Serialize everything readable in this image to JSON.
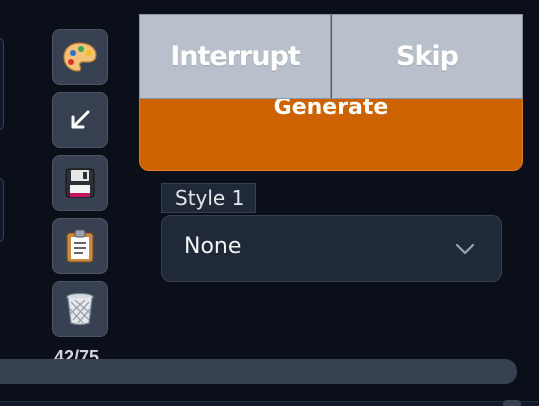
{
  "toolbar": {
    "buttons": [
      {
        "name": "palette",
        "icon": "palette-icon"
      },
      {
        "name": "paste",
        "icon": "arrow-down-left-icon"
      },
      {
        "name": "save",
        "icon": "floppy-disk-icon"
      },
      {
        "name": "clipboard",
        "icon": "clipboard-icon"
      },
      {
        "name": "trash",
        "icon": "trash-icon"
      }
    ],
    "token_counter": "42/75"
  },
  "generate": {
    "label": "Generate",
    "interrupt_label": "Interrupt",
    "skip_label": "Skip",
    "accent_color": "#cc6300"
  },
  "styles": {
    "label": "Style 1",
    "selected": "None"
  }
}
